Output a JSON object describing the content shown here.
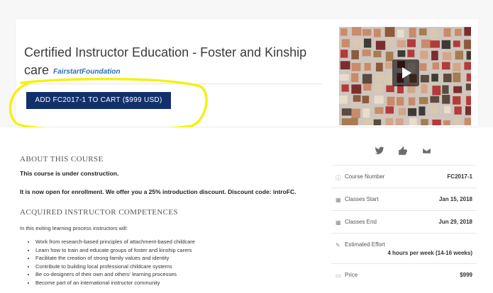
{
  "course": {
    "title": "Certified Instructor Education - Foster and Kinship care",
    "organization": "FairstartFoundation",
    "add_to_cart_label": "ADD FC2017-1 TO CART ($999 USD)"
  },
  "about": {
    "heading": "ABOUT THIS COURSE",
    "construction_note": "This course is under construction.",
    "enrollment_note": "It is now open for enrollment. We offer you a 25% introduction discount. Discount code: introFC."
  },
  "competences": {
    "heading": "ACQUIRED INSTRUCTOR COMPETENCES",
    "intro": "In this exiting learning process instructors will:",
    "items": [
      "Work from research-based principles of attachment-based childcare",
      "Learn how to train and educate groups of foster and kinship carers",
      "Facilitate the creation of strong family values and identity",
      "Contribute to building local professional childcare systems",
      "Be co-designers of their own and others' learning processes",
      "Become part of an international instructor community"
    ]
  },
  "social": {
    "icons": [
      "twitter-icon",
      "facebook-like-icon",
      "email-icon"
    ]
  },
  "sidebar": {
    "rows": [
      {
        "icon": "info-icon",
        "label": "Course Number",
        "value": "FC2017-1"
      },
      {
        "icon": "calendar-icon",
        "label": "Classes Start",
        "value": "Jan 15, 2018"
      },
      {
        "icon": "calendar-icon",
        "label": "Classes End",
        "value": "Jun 29, 2018"
      },
      {
        "icon": "pencil-icon",
        "label": "Estimated Effort",
        "value": "4 hours per week (14-16 weeks)"
      },
      {
        "icon": "price-tag-icon",
        "label": "Price",
        "value": "$999"
      }
    ]
  },
  "colors": {
    "button": "#12306b",
    "organization_link": "#2a6fb5",
    "highlight": "#f2f215"
  }
}
